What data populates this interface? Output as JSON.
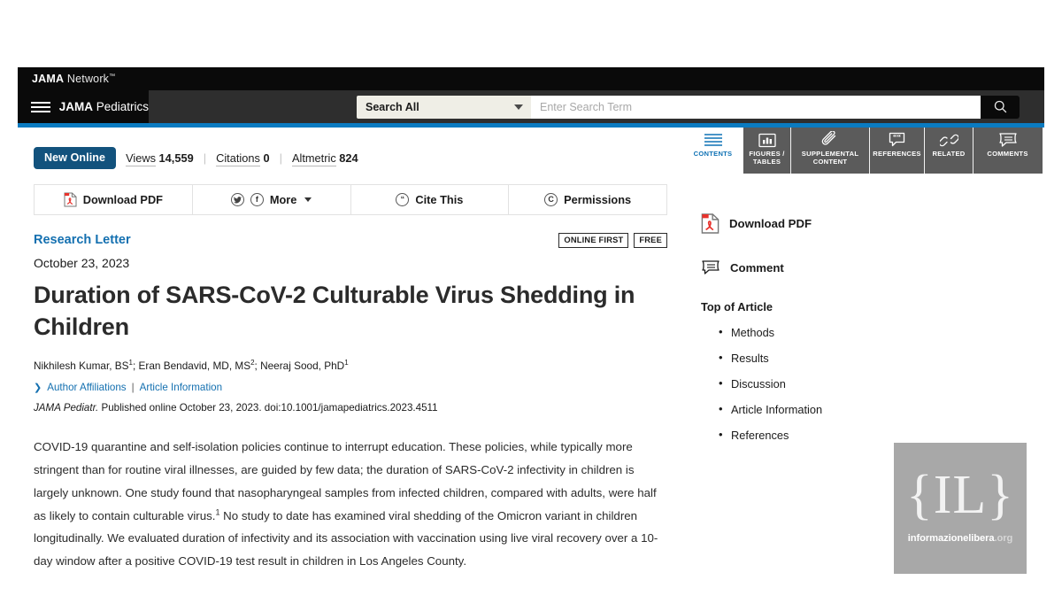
{
  "header": {
    "network_logo": "JAMA Network",
    "journal_logo": "JAMA Pediatrics",
    "journal_logo_bold": "JAMA",
    "journal_logo_rest": " Pediatrics",
    "menu_icon": "hamburger-icon"
  },
  "search": {
    "scope_label": "Search All",
    "placeholder": "Enter Search Term",
    "value": "",
    "button_icon": "search-icon"
  },
  "metrics": {
    "status_badge": "New Online",
    "views_label": "Views",
    "views_value": "14,559",
    "citations_label": "Citations",
    "citations_value": "0",
    "altmetric_label": "Altmetric",
    "altmetric_value": "824",
    "separator": "|"
  },
  "actions": [
    {
      "label": "Download PDF",
      "icon": "pdf-icon"
    },
    {
      "label": "More",
      "icon": "share-icons"
    },
    {
      "label": "Cite This",
      "icon": "quote-icon"
    },
    {
      "label": "Permissions",
      "icon": "copyright-icon"
    }
  ],
  "article": {
    "type": "Research Letter",
    "flag_online_first": "ONLINE FIRST",
    "flag_free": "FREE",
    "date": "October 23, 2023",
    "title": "Duration of SARS-CoV-2 Culturable Virus Shedding in Children",
    "authors_html": "Nikhilesh Kumar, BS<sup>1</sup>; Eran Bendavid, MD, MS<sup>2</sup>; Neeraj Sood, PhD<sup>1</sup>",
    "author_affiliations_link": "Author Affiliations",
    "article_information_link": "Article Information",
    "links_separator": "|",
    "citation_html": "<i>JAMA Pediatr.</i> Published online October 23, 2023. doi:10.1001/jamapediatrics.2023.4511",
    "body_html": "COVID-19 quarantine and self-isolation policies continue to interrupt education. These policies, while typically more stringent than for routine viral illnesses, are guided by few data; the duration of SARS-CoV-2 infectivity in children is largely unknown. One study found that nasopharyngeal samples from infected children, compared with adults, were half as likely to contain culturable virus.<sup>1</sup> No study to date has examined viral shedding of the Omicron variant in children longitudinally. We evaluated duration of infectivity and its association with vaccination using live viral recovery over a 10-day window after a positive COVID-19 test result in children in Los Angeles County."
  },
  "sidebar": {
    "tabs": [
      {
        "label": "CONTENTS",
        "icon": "contents-lines-icon",
        "active": true
      },
      {
        "label": "FIGURES / TABLES",
        "icon": "bar-chart-icon",
        "active": false
      },
      {
        "label": "SUPPLEMENTAL CONTENT",
        "icon": "paperclip-icon",
        "active": false
      },
      {
        "label": "REFERENCES",
        "icon": "quote-bubble-icon",
        "active": false
      },
      {
        "label": "RELATED",
        "icon": "link-chain-icon",
        "active": false
      },
      {
        "label": "COMMENTS",
        "icon": "comment-bubble-icon",
        "active": false
      }
    ],
    "download_pdf": "Download PDF",
    "comment": "Comment",
    "toc_heading": "Top of Article",
    "toc_items": [
      "Methods",
      "Results",
      "Discussion",
      "Article Information",
      "References"
    ]
  },
  "watermark": {
    "mark": "{IL}",
    "name": "informazionelibera",
    "tld": ".org"
  },
  "colors": {
    "accent_blue": "#0a7bc1",
    "link_blue": "#1470b0",
    "badge_blue": "#12527d",
    "tab_gray": "#5b5b5b",
    "header_black": "#0a0a0a"
  }
}
